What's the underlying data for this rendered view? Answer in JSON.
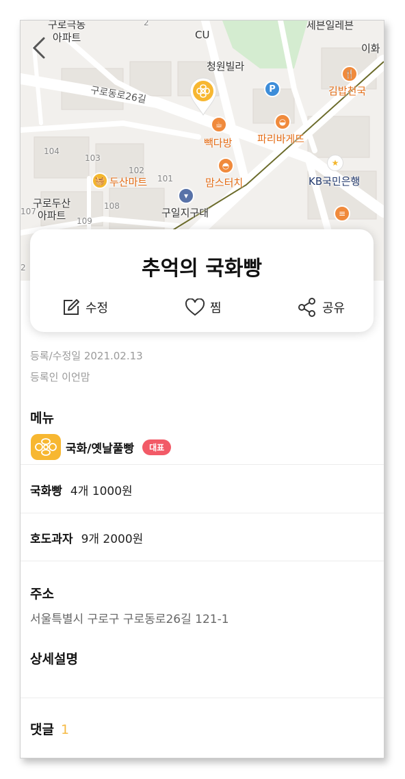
{
  "map": {
    "labels": {
      "apt_top": "구로극동\n아파트",
      "cu": "CU",
      "seven": "세븐일레븐",
      "ewha": "이화",
      "villa": "청원빌라",
      "road": "구로동로26길",
      "gimbap": "김밥천국",
      "paik": "빽다방",
      "paris": "파리바게뜨",
      "doosan": "두산마트",
      "moms": "맘스터치",
      "kb": "KB국민은행",
      "police": "구일지구대",
      "apt_bottom": "구로두산\n아파트",
      "n104": "104",
      "n103": "103",
      "n102": "102",
      "n101": "101",
      "n108": "108",
      "n109": "109",
      "n107": "107",
      "n2": "2",
      "n2b": "2"
    }
  },
  "store": {
    "title": "추억의 국화빵",
    "actions": {
      "edit": "수정",
      "like": "찜",
      "share": "공유"
    }
  },
  "meta": {
    "updated": "등록/수정일 2021.02.13",
    "author": "등록인 이언맘"
  },
  "menu": {
    "title": "메뉴",
    "representative": {
      "name": "국화/옛날풀빵",
      "badge": "대표"
    },
    "items": [
      {
        "name": "국화빵",
        "price": "4개 1000원"
      },
      {
        "name": "호도과자",
        "price": "9개 2000원"
      }
    ]
  },
  "address": {
    "title": "주소",
    "value": "서울특별시 구로구 구로동로26길 121-1"
  },
  "detail": {
    "title": "상세설명"
  },
  "comments": {
    "title": "댓글",
    "count": "1"
  },
  "colors": {
    "accent": "#f25a67",
    "poi_orange": "#f08a3c",
    "count_yellow": "#f5b942"
  }
}
